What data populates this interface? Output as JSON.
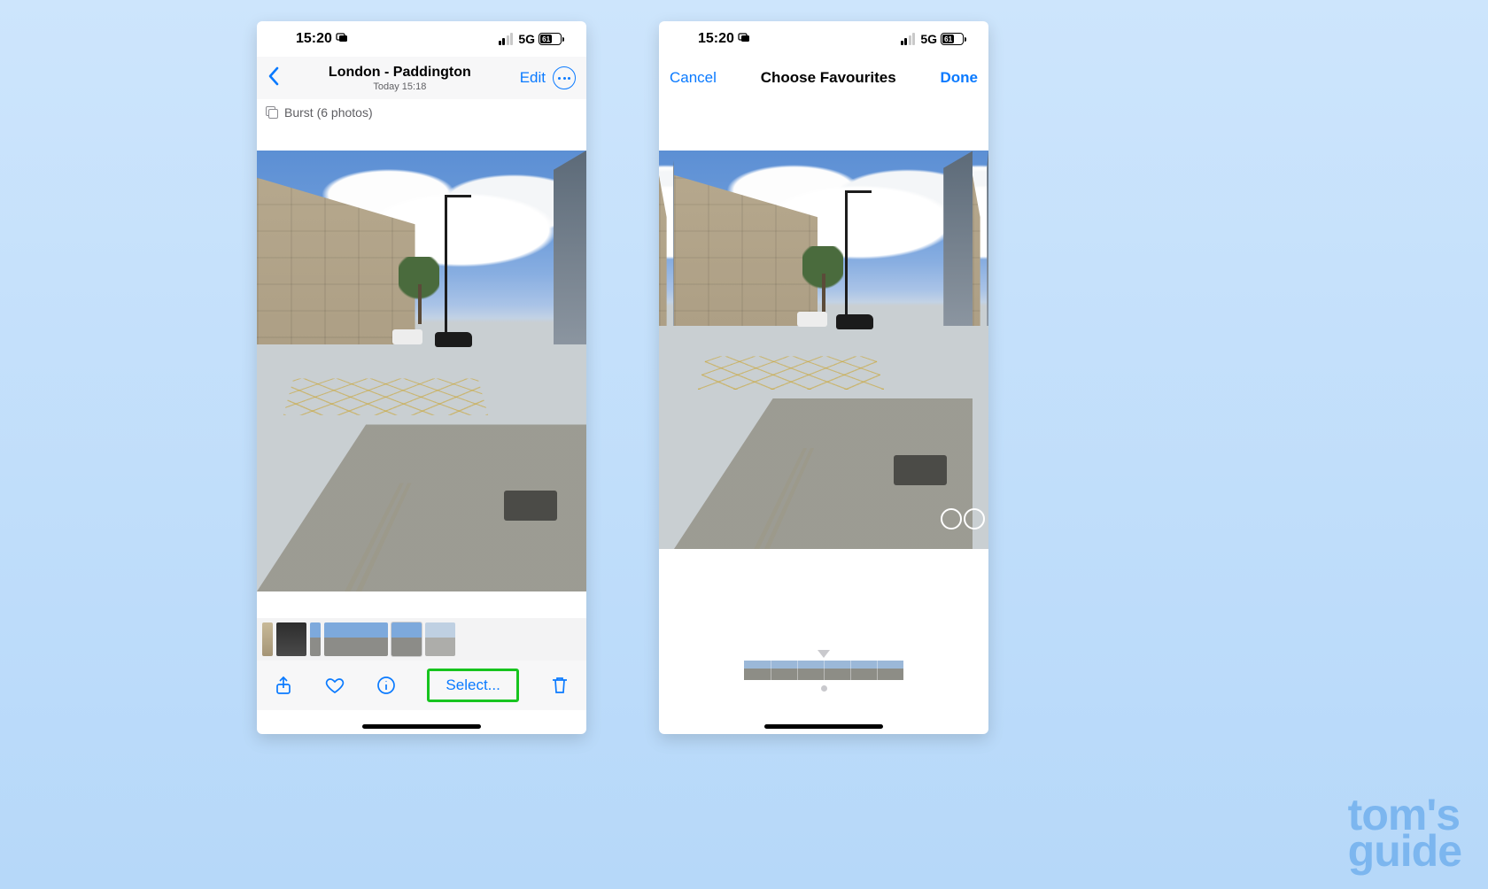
{
  "status": {
    "time": "15:20",
    "network": "5G",
    "battery": "61"
  },
  "left": {
    "nav": {
      "title": "London - Paddington",
      "subtitle": "Today  15:18",
      "edit": "Edit"
    },
    "burst": "Burst (6 photos)",
    "toolbar": {
      "select": "Select..."
    }
  },
  "right": {
    "nav": {
      "cancel": "Cancel",
      "title": "Choose Favourites",
      "done": "Done"
    }
  },
  "watermark": {
    "line1": "tom's",
    "line2": "guide"
  }
}
